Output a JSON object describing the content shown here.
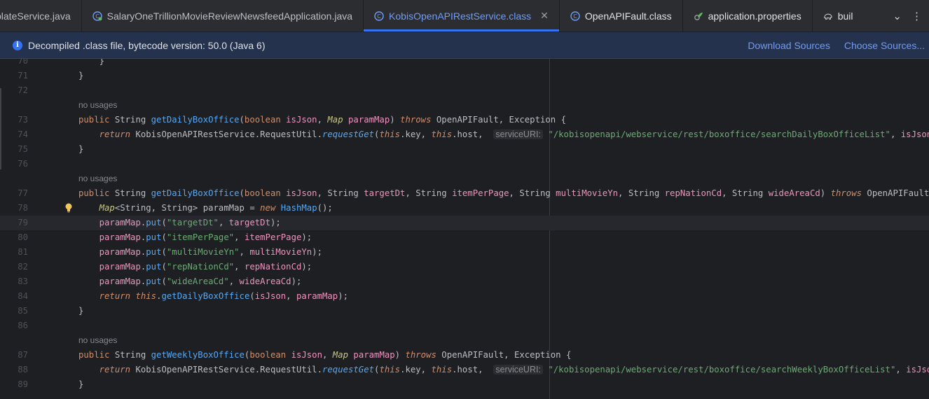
{
  "tabs": [
    {
      "label": "plateService.java",
      "icon": "java-class-icon",
      "kind": "java"
    },
    {
      "label": "SalaryOneTrillionMovieReviewNewsfeedApplication.java",
      "icon": "spring-boot-class-icon",
      "kind": "java"
    },
    {
      "label": "KobisOpenAPIRestService.class",
      "icon": "class-file-icon",
      "kind": "cls",
      "active": true
    },
    {
      "label": "OpenAPIFault.class",
      "icon": "class-file-icon",
      "kind": "cls"
    },
    {
      "label": "application.properties",
      "icon": "properties-leaf-icon",
      "kind": "cls"
    },
    {
      "label": "buil",
      "icon": "gradle-elephant-icon",
      "kind": "cls"
    }
  ],
  "banner": {
    "message": "Decompiled .class file, bytecode version: 50.0 (Java 6)",
    "download_sources": "Download Sources",
    "choose_sources": "Choose Sources..."
  },
  "colors": {
    "accent": "#3574f0",
    "keyword": "#cf8e6d",
    "method": "#56a8f5",
    "param": "#ed94c0",
    "string": "#6aab73",
    "banner_bg": "#25324d"
  },
  "editor": {
    "lines": [
      {
        "n": "70",
        "code": "    }"
      },
      {
        "n": "71",
        "code": "}"
      },
      {
        "n": "72",
        "code": ""
      },
      {
        "n": "",
        "hint": "no usages"
      },
      {
        "n": "73",
        "code": "public String getDailyBoxOffice(boolean isJson, Map paramMap) throws OpenAPIFault, Exception {"
      },
      {
        "n": "74",
        "code": "    return KobisOpenAPIRestService.RequestUtil.requestGet(this.key, this.host,  serviceURI: \"/kobisopenapi/webservice/rest/boxoffice/searchDailyBoxOfficeList\", isJson, paramMap);"
      },
      {
        "n": "75",
        "code": "}"
      },
      {
        "n": "76",
        "code": ""
      },
      {
        "n": "",
        "hint": "no usages"
      },
      {
        "n": "77",
        "code": "public String getDailyBoxOffice(boolean isJson, String targetDt, String itemPerPage, String multiMovieYn, String repNationCd, String wideAreaCd) throws OpenAPIFault, Exception {"
      },
      {
        "n": "78",
        "code": "    Map<String, String> paramMap = new HashMap();"
      },
      {
        "n": "79",
        "code": "    paramMap.put(\"targetDt\", targetDt);"
      },
      {
        "n": "80",
        "code": "    paramMap.put(\"itemPerPage\", itemPerPage);"
      },
      {
        "n": "81",
        "code": "    paramMap.put(\"multiMovieYn\", multiMovieYn);"
      },
      {
        "n": "82",
        "code": "    paramMap.put(\"repNationCd\", repNationCd);"
      },
      {
        "n": "83",
        "code": "    paramMap.put(\"wideAreaCd\", wideAreaCd);"
      },
      {
        "n": "84",
        "code": "    return this.getDailyBoxOffice(isJson, paramMap);"
      },
      {
        "n": "85",
        "code": "}"
      },
      {
        "n": "86",
        "code": ""
      },
      {
        "n": "",
        "hint": "no usages"
      },
      {
        "n": "87",
        "code": "public String getWeeklyBoxOffice(boolean isJson, Map paramMap) throws OpenAPIFault, Exception {"
      },
      {
        "n": "88",
        "code": "    return KobisOpenAPIRestService.RequestUtil.requestGet(this.key, this.host,  serviceURI: \"/kobisopenapi/webservice/rest/boxoffice/searchWeeklyBoxOfficeList\", isJson, paramMap);"
      },
      {
        "n": "89",
        "code": "}"
      }
    ]
  }
}
